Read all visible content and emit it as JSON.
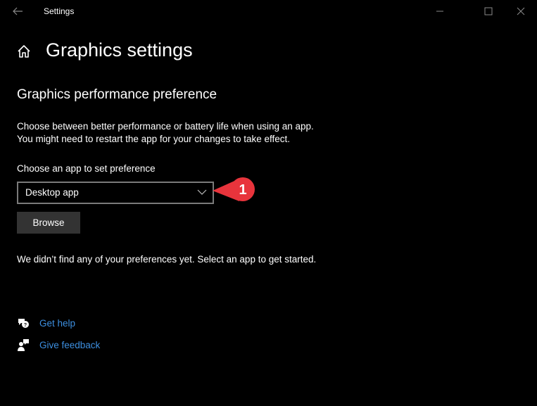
{
  "window": {
    "title": "Settings",
    "controls": [
      "minimize",
      "maximize",
      "close"
    ]
  },
  "header": {
    "page_title": "Graphics settings"
  },
  "section": {
    "title": "Graphics performance preference",
    "description_line1": "Choose between better performance or battery life when using an app.",
    "description_line2": "You might need to restart the app for your changes to take effect.",
    "chooser_label": "Choose an app to set preference",
    "dropdown_value": "Desktop app",
    "browse_label": "Browse",
    "empty_message": "We didn’t find any of your preferences yet. Select an app to get started."
  },
  "links": {
    "get_help": "Get help",
    "give_feedback": "Give feedback"
  },
  "annotation": {
    "callout_number": "1",
    "callout_color": "#e8343c"
  },
  "colors": {
    "background": "#000000",
    "link": "#3d8fe0",
    "button_bg": "#333333",
    "dropdown_border": "#7a7a7a"
  }
}
